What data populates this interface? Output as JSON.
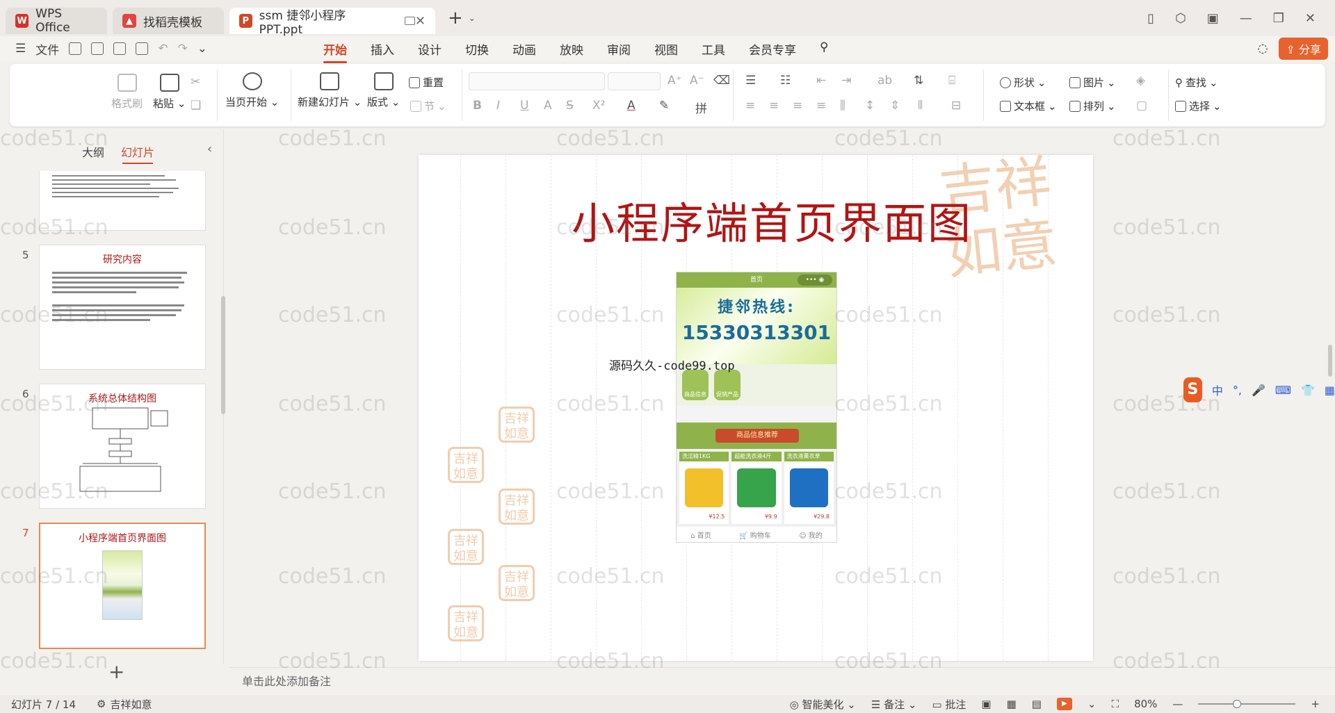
{
  "tabs": [
    {
      "label": "WPS Office",
      "color": "#d6322a"
    },
    {
      "label": "找稻壳模板",
      "color": "#e24343"
    },
    {
      "label": "ssm 捷邻小程序 PPT.ppt",
      "color": "#d24726"
    }
  ],
  "menu": {
    "file": "文件",
    "tabs": [
      "开始",
      "插入",
      "设计",
      "切换",
      "动画",
      "放映",
      "审阅",
      "视图",
      "工具",
      "会员专享"
    ],
    "active_tab": "开始",
    "share": "分享"
  },
  "ribbon": {
    "format_painter": "格式刷",
    "paste": "粘贴",
    "play_current": "当页开始",
    "new_slide": "新建幻灯片",
    "layout": "版式",
    "reset": "重置",
    "section": "节",
    "shape": "形状",
    "picture": "图片",
    "textbox": "文本框",
    "arrange": "排列",
    "find": "查找",
    "select": "选择"
  },
  "left_panel": {
    "outline_tab": "大纲",
    "slides_tab": "幻灯片",
    "slides": [
      {
        "num": "5",
        "title": "研究内容"
      },
      {
        "num": "6",
        "title": "系统总体结构图"
      },
      {
        "num": "7",
        "title": "小程序端首页界面图"
      }
    ]
  },
  "slide": {
    "title": "小程序端首页界面图",
    "seal_text": "吉祥如意",
    "phone": {
      "topbar": "首页",
      "hotline": "捷邻热线:",
      "phone_number": "15330313301",
      "icon1": "商品信息",
      "icon2": "促销产品",
      "section_label": "商品信息推荐",
      "products": [
        {
          "name": "洗洁精1KG",
          "price": "¥12.5",
          "color": "#f2c02b"
        },
        {
          "name": "超能洗衣液4斤",
          "price": "¥9.9",
          "color": "#37a34a"
        },
        {
          "name": "洗衣液薰衣草",
          "price": "¥29.8",
          "color": "#1f6fc2"
        }
      ],
      "nav": [
        "首页",
        "购物车",
        "我的"
      ]
    },
    "overlay_text": "源码久久-code99.top"
  },
  "notes_placeholder": "单击此处添加备注",
  "status": {
    "slide_count": "幻灯片 7 / 14",
    "theme": "吉祥如意",
    "beautify": "智能美化",
    "notes": "备注",
    "comments": "批注",
    "zoom": "80%"
  },
  "watermark": "code51.cn",
  "ime": {
    "lang": "中"
  }
}
